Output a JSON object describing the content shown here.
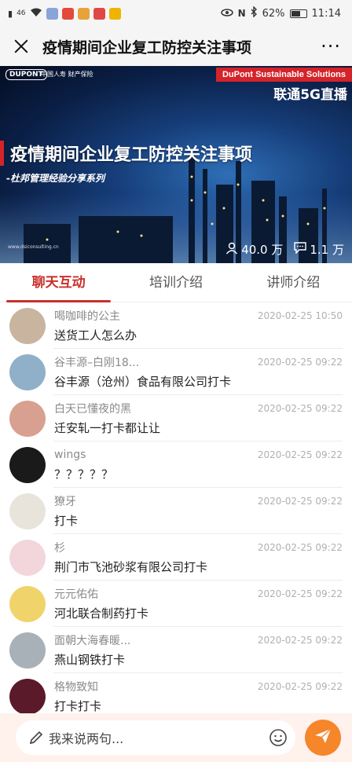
{
  "status_bar": {
    "signal": "46",
    "battery": "62%",
    "battery_level": 0.62,
    "time": "11:14"
  },
  "header": {
    "title": "疫情期间企业复工防控关注事项",
    "more_label": "···"
  },
  "banner": {
    "logo_dupont": "DUPONT",
    "logo_chinalife": "中国人寿 财产保险",
    "badge": "DuPont Sustainable Solutions",
    "live_label": "联通5G直播",
    "title": "疫情期间企业复工防控关注事项",
    "subtitle": "-杜邦管理经验分享系列",
    "url": "www.dsiconsulting.cn",
    "viewers": "40.0 万",
    "comments": "1.1 万"
  },
  "tabs": [
    {
      "label": "聊天互动",
      "active": true
    },
    {
      "label": "培训介绍",
      "active": false
    },
    {
      "label": "讲师介绍",
      "active": false
    }
  ],
  "messages": [
    {
      "nick": "喝咖啡的公主",
      "time": "2020-02-25 10:50",
      "text": "送货工人怎么办",
      "avatar_color": "#c9b4a0"
    },
    {
      "nick": "谷丰源–白刚18...",
      "time": "2020-02-25 09:22",
      "text": "谷丰源（沧州）食品有限公司打卡",
      "avatar_color": "#8fb0c8"
    },
    {
      "nick": "白天已懂夜的黑",
      "time": "2020-02-25 09:22",
      "text": "迁安轧一打卡都让让",
      "avatar_color": "#d8a090"
    },
    {
      "nick": "wings",
      "time": "2020-02-25 09:22",
      "text": "？？？？？",
      "avatar_color": "#1a1a1a"
    },
    {
      "nick": "獠牙",
      "time": "2020-02-25 09:22",
      "text": "打卡",
      "avatar_color": "#e8e4dc"
    },
    {
      "nick": "杉",
      "time": "2020-02-25 09:22",
      "text": "荆门市飞池砂浆有限公司打卡",
      "avatar_color": "#f2d6dc"
    },
    {
      "nick": "元元佑佑",
      "time": "2020-02-25 09:22",
      "text": "河北联合制药打卡",
      "avatar_color": "#f0d36a"
    },
    {
      "nick": "面朝大海春暖...",
      "time": "2020-02-25 09:22",
      "text": "燕山钢铁打卡",
      "avatar_color": "#a8b0b8"
    },
    {
      "nick": "格物致知",
      "time": "2020-02-25 09:22",
      "text": "打卡打卡",
      "avatar_color": "#5a1a2a"
    }
  ],
  "input": {
    "placeholder": "我来说两句..."
  },
  "colors": {
    "accent": "#c9302c",
    "send_button": "#f5862a",
    "badge": "#d5232a"
  }
}
